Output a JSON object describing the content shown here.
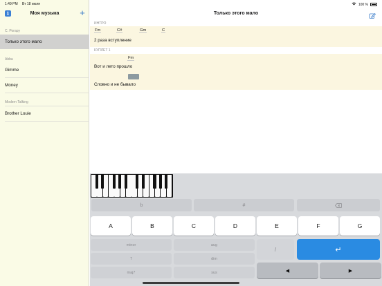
{
  "status": {
    "time": "1:49 PM",
    "date": "Вт 18 июля",
    "battery": "100 %"
  },
  "sidebar": {
    "title": "Моя музыка",
    "info_glyph": "i",
    "add_glyph": "+",
    "sections": [
      {
        "header": "С. Рогару",
        "songs": [
          "Только этого мало"
        ]
      },
      {
        "header": "Abba",
        "songs": [
          "Gimme",
          "Money"
        ]
      },
      {
        "header": "Modern Talking",
        "songs": [
          "Brother Louie"
        ]
      }
    ]
  },
  "song": {
    "title": "Только этого мало",
    "parts": [
      {
        "label": "ИНТРО",
        "chords": [
          "Fm",
          "C#",
          "Gm",
          "C"
        ],
        "lyric": "2 раза вступление"
      },
      {
        "label": "КУПЛЕТ 1",
        "chords": [
          "Fm"
        ],
        "lines": [
          "Вот и лето прошло",
          "Словно и не бывало"
        ]
      }
    ]
  },
  "keyboard": {
    "modifiers": [
      "b",
      "#",
      "⌫"
    ],
    "notes": [
      "A",
      "B",
      "C",
      "D",
      "E",
      "F",
      "G"
    ],
    "qualities": [
      "minor",
      "aug",
      "7",
      "dim",
      "maj7",
      "sus"
    ],
    "slash": "/",
    "enter": "↵",
    "arrows": [
      "◀",
      "▶"
    ]
  },
  "icons": {
    "info": "info-icon",
    "add": "plus-icon",
    "edit": "edit-icon",
    "wifi": "wifi-icon",
    "battery": "battery-icon",
    "backspace": "backspace-icon",
    "enter": "return-icon"
  },
  "colors": {
    "accent": "#2a8be2",
    "sidebar_bg": "#fafbe6",
    "block_bg": "#fbf6e0",
    "selected_row": "#d1d1cf"
  }
}
